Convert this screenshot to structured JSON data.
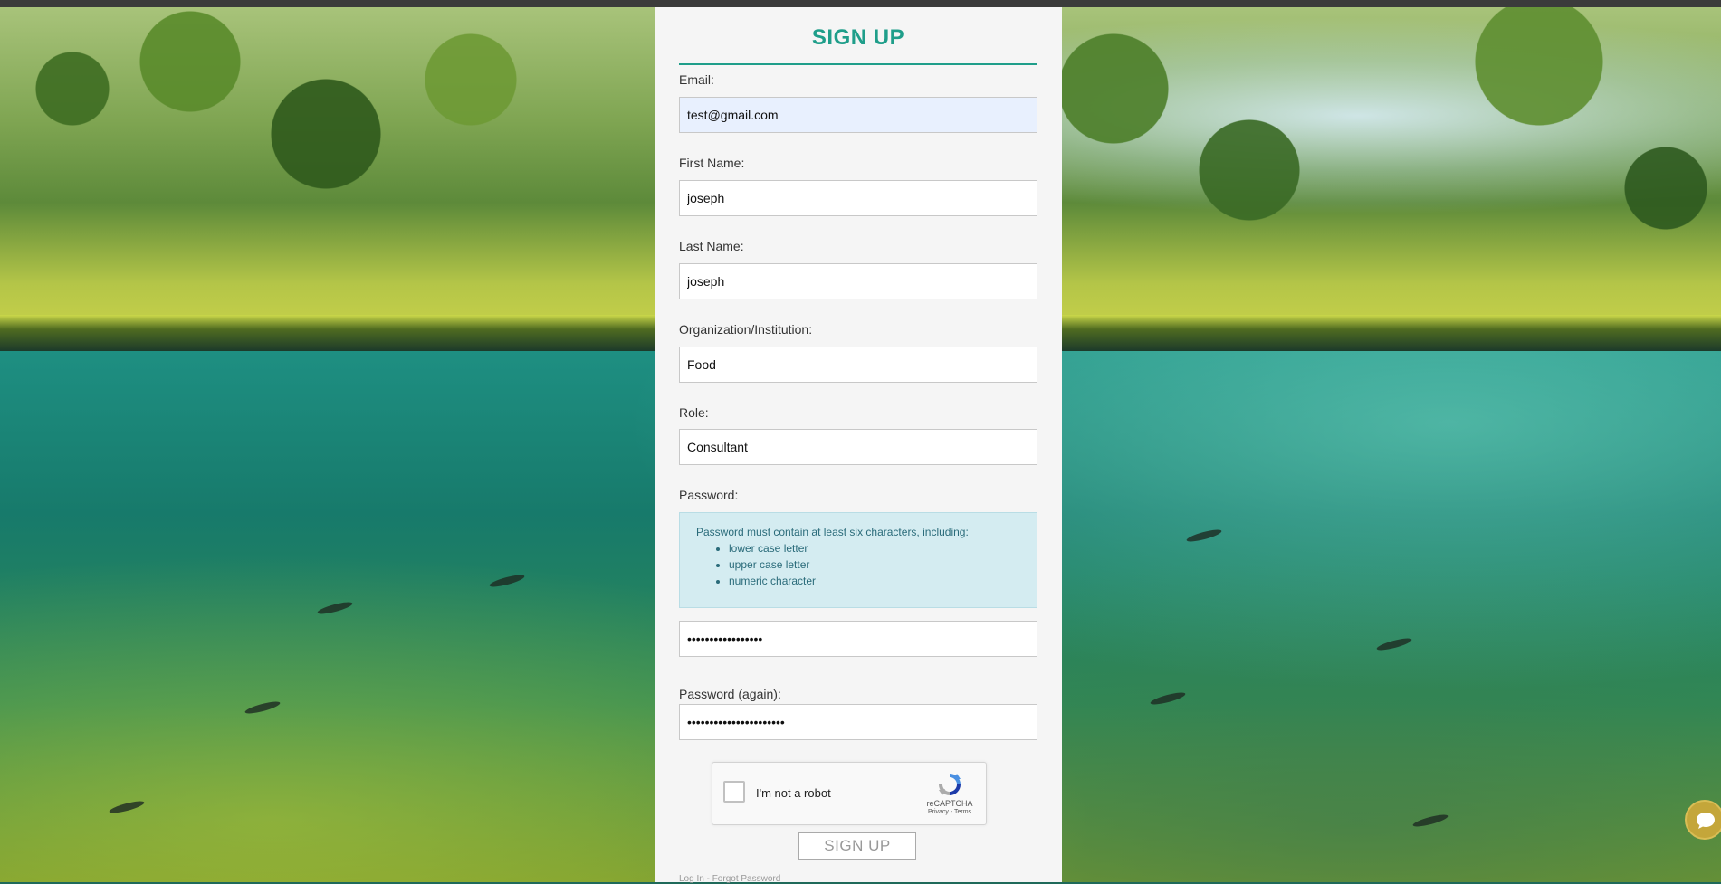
{
  "form": {
    "title": "SIGN UP",
    "fields": {
      "email": {
        "label": "Email:",
        "value": "test@gmail.com"
      },
      "first_name": {
        "label": "First Name:",
        "value": "joseph"
      },
      "last_name": {
        "label": "Last Name:",
        "value": "joseph"
      },
      "organization": {
        "label": "Organization/Institution:",
        "value": "Food"
      },
      "role": {
        "label": "Role:",
        "value": "Consultant"
      },
      "password": {
        "label": "Password:",
        "value": "•••••••••••••••••"
      },
      "password_again": {
        "label": "Password (again):",
        "value": "••••••••••••••••••••••"
      }
    },
    "password_help": {
      "intro": "Password must contain at least six characters, including:",
      "rules": [
        "lower case letter",
        "upper case letter",
        "numeric character"
      ]
    },
    "captcha": {
      "label": "I'm not a robot",
      "brand": "reCAPTCHA",
      "privacy": "Privacy",
      "separator": " - ",
      "terms": "Terms"
    },
    "submit_label": "SIGN UP",
    "links": {
      "login": "Log In",
      "separator": " - ",
      "forgot": "Forgot Password"
    }
  },
  "colors": {
    "accent": "#1f9e8a",
    "help_bg": "#d4ecf1",
    "autofill_bg": "#e8f0fe",
    "chat_button": "#c4a63a"
  },
  "icons": [
    "recaptcha-icon",
    "chat-icon"
  ]
}
